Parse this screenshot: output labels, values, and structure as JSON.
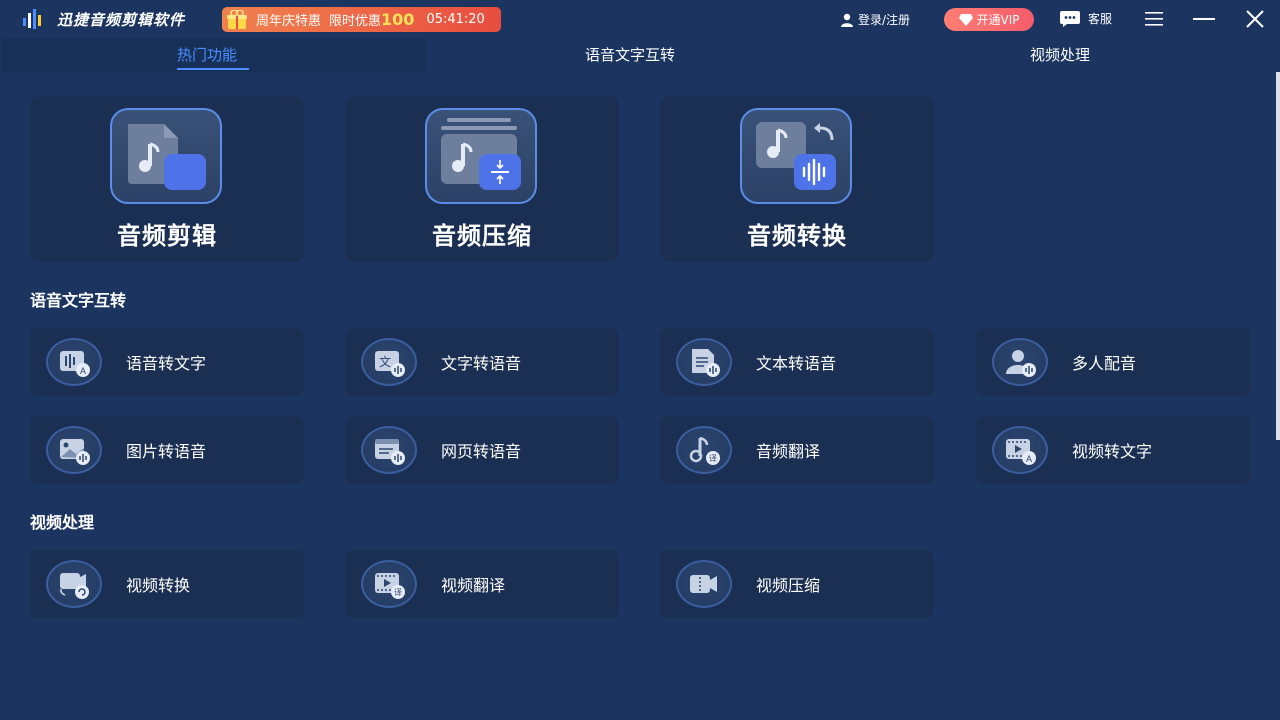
{
  "app": {
    "title": "迅捷音频剪辑软件",
    "promo": {
      "label": "周年庆特惠",
      "limit": "限时优惠",
      "amount": "100",
      "timer": "05:41:20"
    },
    "login": "登录/注册",
    "vip": "开通VIP",
    "service": "客服"
  },
  "tabs": [
    {
      "label": "热门功能",
      "active": true
    },
    {
      "label": "语音文字互转",
      "active": false
    },
    {
      "label": "视频处理",
      "active": false
    }
  ],
  "hot": [
    {
      "label": "音频剪辑",
      "icon": "audio-edit-icon"
    },
    {
      "label": "音频压缩",
      "icon": "audio-compress-icon"
    },
    {
      "label": "音频转换",
      "icon": "audio-convert-icon"
    }
  ],
  "sections": {
    "speech": {
      "title": "语音文字互转",
      "items": [
        {
          "label": "语音转文字",
          "icon": "speech-to-text-icon"
        },
        {
          "label": "文字转语音",
          "icon": "text-to-speech-icon"
        },
        {
          "label": "文本转语音",
          "icon": "document-to-speech-icon"
        },
        {
          "label": "多人配音",
          "icon": "multi-voice-icon"
        },
        {
          "label": "图片转语音",
          "icon": "image-to-speech-icon"
        },
        {
          "label": "网页转语音",
          "icon": "webpage-to-speech-icon"
        },
        {
          "label": "音频翻译",
          "icon": "audio-translate-icon"
        },
        {
          "label": "视频转文字",
          "icon": "video-to-text-icon"
        }
      ]
    },
    "video": {
      "title": "视频处理",
      "items": [
        {
          "label": "视频转换",
          "icon": "video-convert-icon"
        },
        {
          "label": "视频翻译",
          "icon": "video-translate-icon"
        },
        {
          "label": "视频压缩",
          "icon": "video-compress-icon"
        }
      ]
    }
  },
  "colors": {
    "background": "#1b3560",
    "card": "#1a2f52",
    "accent": "#4b8cff",
    "promo": "#e84d3f",
    "vip": "#f35c6a"
  }
}
